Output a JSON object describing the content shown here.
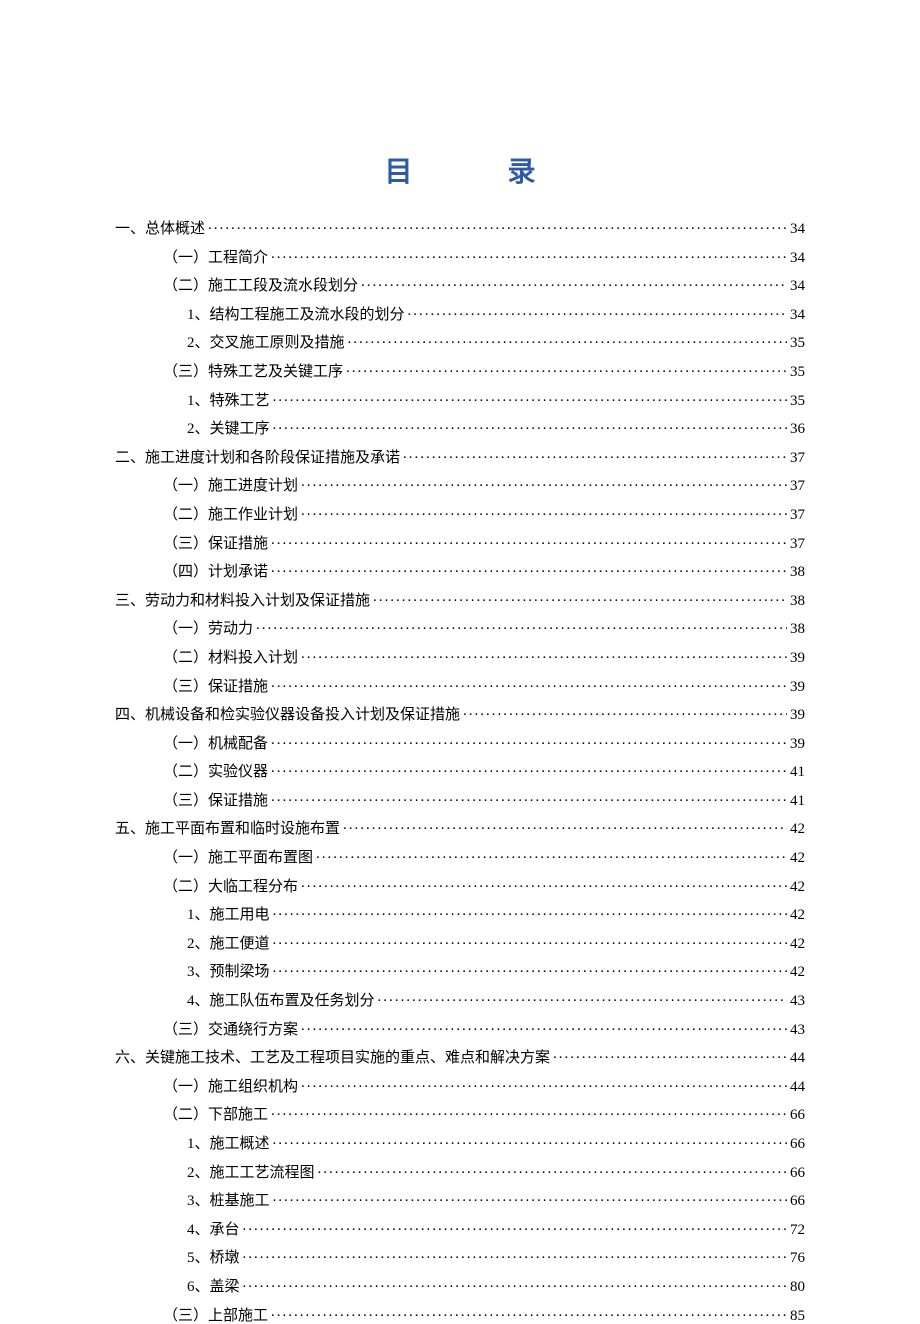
{
  "title": {
    "char1": "目",
    "char2": "录"
  },
  "toc": [
    {
      "level": 0,
      "label": "一、总体概述",
      "page": "34"
    },
    {
      "level": 1,
      "label": "（一）工程简介",
      "page": "34"
    },
    {
      "level": 1,
      "label": "（二）施工工段及流水段划分",
      "page": "34"
    },
    {
      "level": 2,
      "label": "1、结构工程施工及流水段的划分",
      "page": "34"
    },
    {
      "level": 2,
      "label": "2、交叉施工原则及措施",
      "page": "35"
    },
    {
      "level": 1,
      "label": "（三）特殊工艺及关键工序",
      "page": "35"
    },
    {
      "level": 2,
      "label": "1、特殊工艺",
      "page": "35"
    },
    {
      "level": 2,
      "label": "2、关键工序",
      "page": "36"
    },
    {
      "level": 0,
      "label": "二、施工进度计划和各阶段保证措施及承诺",
      "page": "37"
    },
    {
      "level": 1,
      "label": "（一）施工进度计划",
      "page": "37"
    },
    {
      "level": 1,
      "label": "（二）施工作业计划",
      "page": "37"
    },
    {
      "level": 1,
      "label": "（三）保证措施",
      "page": "37"
    },
    {
      "level": 1,
      "label": "（四）计划承诺",
      "page": "38"
    },
    {
      "level": 0,
      "label": "三、劳动力和材料投入计划及保证措施",
      "page": "38"
    },
    {
      "level": 1,
      "label": "（一）劳动力",
      "page": "38"
    },
    {
      "level": 1,
      "label": "（二）材料投入计划",
      "page": "39"
    },
    {
      "level": 1,
      "label": "（三）保证措施",
      "page": "39"
    },
    {
      "level": 0,
      "label": "四、机械设备和检实验仪器设备投入计划及保证措施",
      "page": "39"
    },
    {
      "level": 1,
      "label": "（一）机械配备",
      "page": "39"
    },
    {
      "level": 1,
      "label": "（二）实验仪器",
      "page": "41"
    },
    {
      "level": 1,
      "label": "（三）保证措施",
      "page": "41"
    },
    {
      "level": 0,
      "label": "五、施工平面布置和临时设施布置",
      "page": "42"
    },
    {
      "level": 1,
      "label": "（一）施工平面布置图",
      "page": "42"
    },
    {
      "level": 1,
      "label": "（二）大临工程分布",
      "page": "42"
    },
    {
      "level": 2,
      "label": "1、施工用电",
      "page": "42"
    },
    {
      "level": 2,
      "label": "2、施工便道",
      "page": "42"
    },
    {
      "level": 2,
      "label": "3、预制梁场",
      "page": "42"
    },
    {
      "level": 2,
      "label": "4、施工队伍布置及任务划分",
      "page": "43"
    },
    {
      "level": 1,
      "label": "（三）交通绕行方案",
      "page": "43"
    },
    {
      "level": 0,
      "label": "六、关键施工技术、工艺及工程项目实施的重点、难点和解决方案",
      "page": "44"
    },
    {
      "level": 1,
      "label": "（一）施工组织机构",
      "page": "44"
    },
    {
      "level": 1,
      "label": "（二）下部施工",
      "page": "66"
    },
    {
      "level": 2,
      "label": "1、施工概述",
      "page": "66"
    },
    {
      "level": 2,
      "label": "2、施工工艺流程图",
      "page": "66"
    },
    {
      "level": 2,
      "label": "3、桩基施工",
      "page": "66"
    },
    {
      "level": 2,
      "label": "4、承台",
      "page": "72"
    },
    {
      "level": 2,
      "label": "5、桥墩",
      "page": "76"
    },
    {
      "level": 2,
      "label": "6、盖梁",
      "page": "80"
    },
    {
      "level": 1,
      "label": "（三）上部施工",
      "page": "85"
    }
  ]
}
